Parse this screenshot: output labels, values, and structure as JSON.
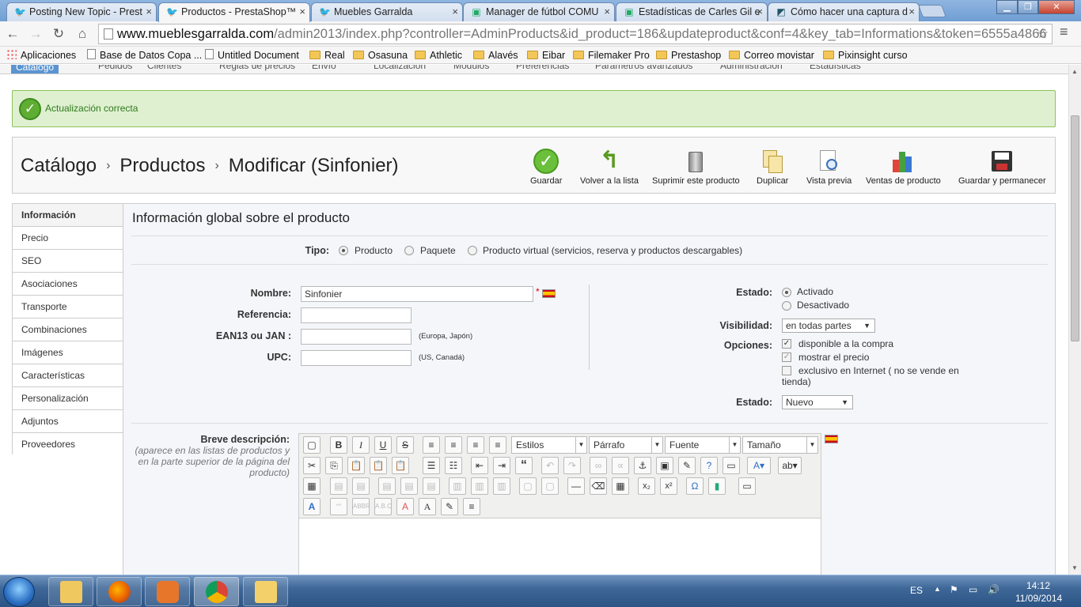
{
  "browser": {
    "tabs": [
      {
        "label": "Posting New Topic - Prest",
        "active": false
      },
      {
        "label": "Productos - PrestaShop™",
        "active": true
      },
      {
        "label": "Muebles Garralda",
        "active": false
      },
      {
        "label": "Manager de fútbol COMU",
        "active": false
      },
      {
        "label": "Estadísticas de Carles Gil e",
        "active": false
      },
      {
        "label": "Cómo hacer una captura d",
        "active": false
      }
    ],
    "url_host": "www.mueblesgarralda.com",
    "url_path": "/admin2013/index.php?controller=AdminProducts&id_product=186&updateproduct&conf=4&key_tab=Informations&token=6555a4866",
    "bookmarks": [
      {
        "label": "Aplicaciones",
        "icon": "apps"
      },
      {
        "label": "Base de Datos Copa ...",
        "icon": "doc"
      },
      {
        "label": "Untitled Document",
        "icon": "doc"
      },
      {
        "label": "Real",
        "icon": "folder"
      },
      {
        "label": "Osasuna",
        "icon": "folder"
      },
      {
        "label": "Athletic",
        "icon": "folder"
      },
      {
        "label": "Alavés",
        "icon": "folder"
      },
      {
        "label": "Eibar",
        "icon": "folder"
      },
      {
        "label": "Filemaker Pro",
        "icon": "folder"
      },
      {
        "label": "Prestashop",
        "icon": "folder"
      },
      {
        "label": "Correo movistar",
        "icon": "folder"
      },
      {
        "label": "Pixinsight curso",
        "icon": "folder"
      }
    ]
  },
  "admin_menu": [
    "Catálogo",
    "Pedidos",
    "Clientes",
    "Reglas de precios",
    "Envío",
    "Localización",
    "Módulos",
    "Preferencias",
    "Parámetros avanzados",
    "Administración",
    "Estadísticas"
  ],
  "alert": {
    "message": "Actualización correcta"
  },
  "breadcrumb": [
    "Catálogo",
    "Productos",
    "Modificar (Sinfonier)"
  ],
  "toolbar": {
    "save": "Guardar",
    "back": "Volver a la lista",
    "delete": "Suprimir este producto",
    "duplicate": "Duplicar",
    "preview": "Vista previa",
    "sales": "Ventas de producto",
    "save_stay": "Guardar y permanecer"
  },
  "sidenav": [
    "Información",
    "Precio",
    "SEO",
    "Asociaciones",
    "Transporte",
    "Combinaciones",
    "Imágenes",
    "Características",
    "Personalización",
    "Adjuntos",
    "Proveedores"
  ],
  "form": {
    "title": "Información global sobre el producto",
    "type_label": "Tipo:",
    "type_options": [
      "Producto",
      "Paquete",
      "Producto virtual (servicios, reserva y productos descargables)"
    ],
    "name_label": "Nombre:",
    "name_value": "Sinfonier",
    "required_mark": "*",
    "ref_label": "Referencia:",
    "ean_label": "EAN13 ou JAN :",
    "ean_hint": "(Europa, Japón)",
    "upc_label": "UPC:",
    "upc_hint": "(US, Canadá)",
    "status_label": "Estado:",
    "status_on": "Activado",
    "status_off": "Desactivado",
    "visibility_label": "Visibilidad:",
    "visibility_value": "en todas partes",
    "options_label": "Opciones:",
    "option_available": "disponible a la compra",
    "option_price": "mostrar el precio",
    "option_online": "exclusivo en Internet ( no se vende en tienda)",
    "condition_label": "Estado:",
    "condition_value": "Nuevo",
    "short_desc_label": "Breve descripción:",
    "short_desc_hint": "(aparece en las listas de productos y en la parte superior de la página del producto)"
  },
  "editor": {
    "styles": "Estilos",
    "format": "Párrafo",
    "font": "Fuente",
    "size": "Tamaño"
  },
  "tray": {
    "lang": "ES",
    "time": "14:12",
    "date": "11/09/2014"
  }
}
